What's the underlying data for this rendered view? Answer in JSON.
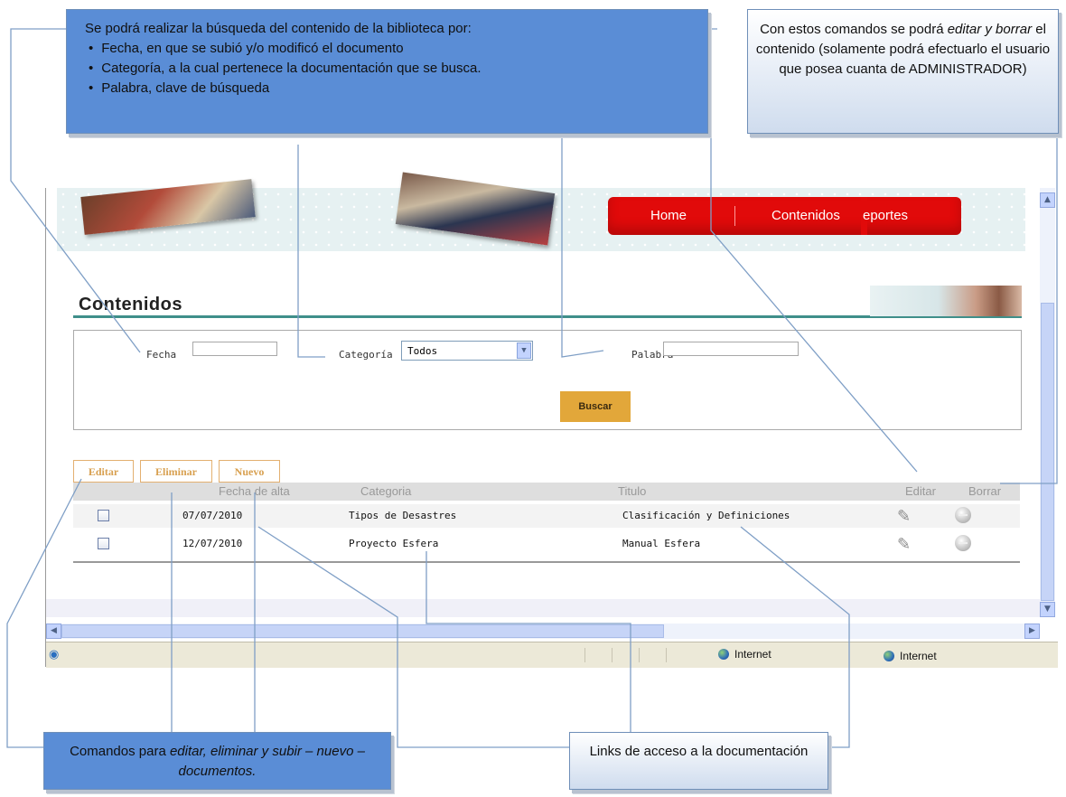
{
  "browser": {
    "nav": {
      "home": "Home",
      "contenidos": "Contenidos",
      "reportes_partial": "eportes"
    },
    "page_title": "Contenidos",
    "filters": {
      "fecha_label": "Fecha",
      "fecha_value": "",
      "categoria_label": "Categoría",
      "categoria_value": "Todos",
      "palabra_label": "Palabra",
      "palabra_value": "",
      "search_button": "Buscar"
    },
    "commands": {
      "edit": "Editar",
      "delete": "Eliminar",
      "new": "Nuevo"
    },
    "table": {
      "columns": {
        "fecha": "Fecha de alta",
        "categoria": "Categoria",
        "titulo": "Titulo",
        "editar": "Editar",
        "borrar": "Borrar"
      },
      "rows": [
        {
          "fecha": "07/07/2010",
          "categoria": "Tipos de Desastres",
          "titulo": "Clasificación y Definiciones"
        },
        {
          "fecha": "12/07/2010",
          "categoria": "Proyecto Esfera",
          "titulo": "Manual Esfera"
        }
      ]
    },
    "statusbar": {
      "zone1": "Internet",
      "zone2": "Internet"
    },
    "icons": [
      "ie-page-icon",
      "pencil-icon",
      "delete-circle-icon",
      "globe-icon",
      "chevron-down-icon"
    ]
  },
  "callouts": {
    "top": {
      "intro": "Se podrá realizar la búsqueda del contenido de la biblioteca por:",
      "items": [
        "Fecha, en que se subió y/o modificó el documento",
        "Categoría, a la cual pertenece la documentación que se busca.",
        "Palabra, clave de búsqueda"
      ]
    },
    "right": {
      "before": "Con estos comandos se podrá ",
      "italic1": "editar y borrar",
      "after": " el contenido (solamente podrá efectuarlo el usuario que posea cuanta de ADMINISTRADOR)"
    },
    "left": {
      "before": "Comandos para ",
      "italic": "editar, eliminar y subir – nuevo – documentos."
    },
    "mid": {
      "text": "Links de acceso a la documentación"
    }
  },
  "colors": {
    "callout_dark": "#5a8dd6",
    "menu_red": "#e10a0a",
    "accent_teal": "#3f8f8a",
    "button_orange": "#e2a73a"
  }
}
